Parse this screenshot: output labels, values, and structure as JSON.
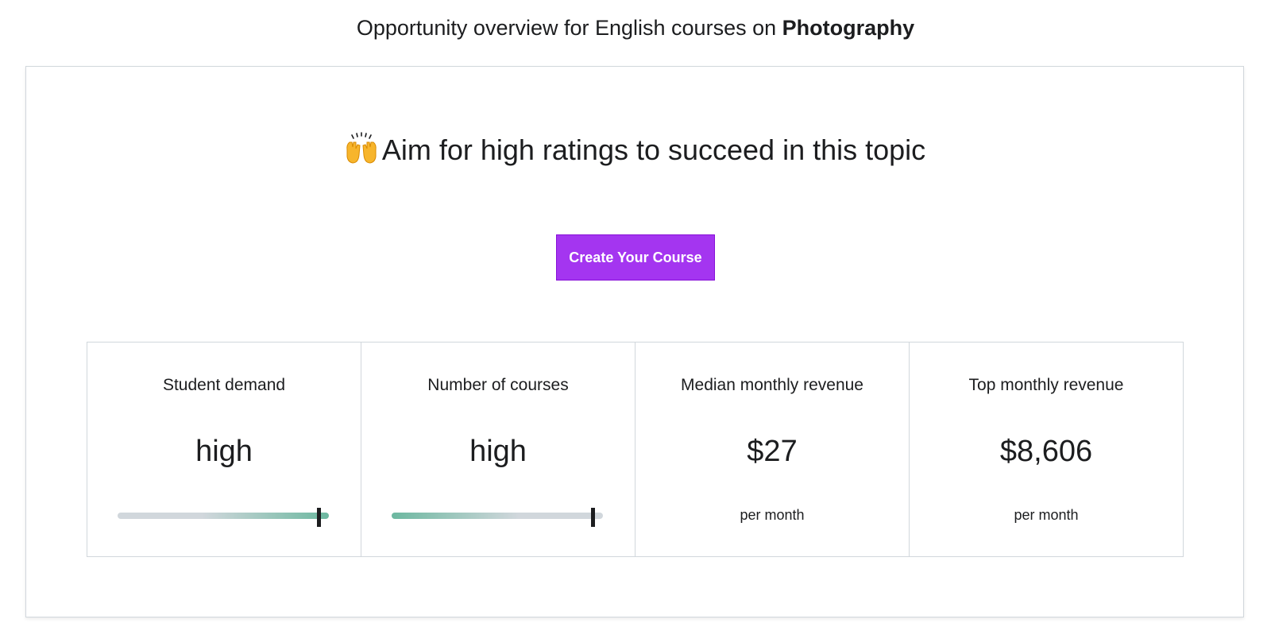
{
  "header": {
    "prefix": "Opportunity overview for English courses on ",
    "topic": "Photography"
  },
  "card": {
    "headline_icon": "raising-hands-emoji",
    "headline": "Aim for high ratings to succeed in this topic",
    "cta_label": "Create Your Course",
    "accent_color": "#a435f0",
    "meter_color": "#6cb8a0"
  },
  "stats": [
    {
      "label": "Student demand",
      "value": "high",
      "meter_level": 0.95
    },
    {
      "label": "Number of courses",
      "value": "high",
      "meter_level": 0.95
    },
    {
      "label": "Median monthly revenue",
      "value": "$27",
      "sub": "per month"
    },
    {
      "label": "Top monthly revenue",
      "value": "$8,606",
      "sub": "per month"
    }
  ]
}
